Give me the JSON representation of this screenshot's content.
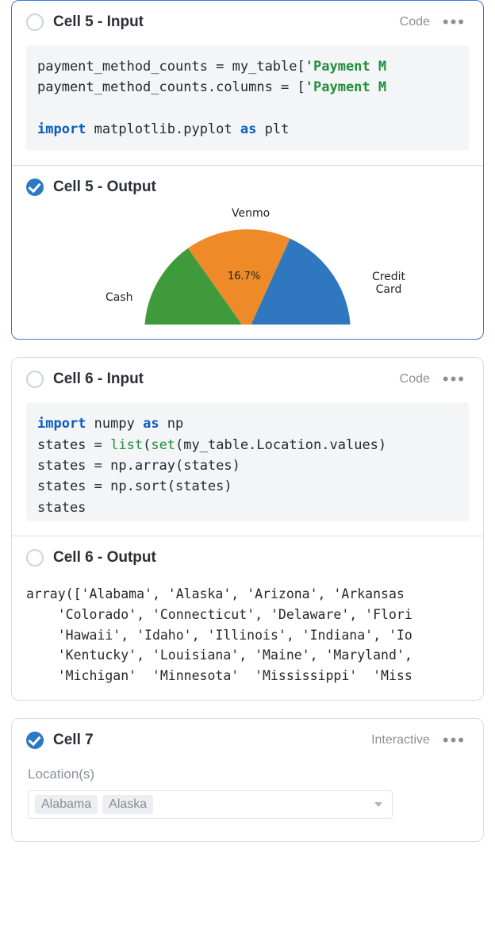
{
  "cells": [
    {
      "input_title": "Cell 5 - Input",
      "input_tag": "Code",
      "output_title": "Cell 5 - Output",
      "code_html": "payment_method_counts = my_table[<span class='kw-str'>'Payment M</span>\npayment_method_counts.columns = [<span class='kw-str'>'Payment M</span>\n\n<span class='kw-blue'>import</span> matplotlib.pyplot <span class='kw-blue'>as</span> plt"
    },
    {
      "input_title": "Cell 6 - Input",
      "input_tag": "Code",
      "output_title": "Cell 6 - Output",
      "code_html": "<span class='kw-blue'>import</span> numpy <span class='kw-blue'>as</span> np\nstates = <span class='kw-builtin'>list</span>(<span class='kw-builtin'>set</span>(my_table.Location.values)\nstates = np.array(states)\nstates = np.sort(states)\nstates",
      "output_text": "array(['Alabama', 'Alaska', 'Arizona', 'Arkansas\n    'Colorado', 'Connecticut', 'Delaware', 'Flori\n    'Hawaii', 'Idaho', 'Illinois', 'Indiana', 'Io\n    'Kentucky', 'Louisiana', 'Maine', 'Maryland',\n    'Michigan'  'Minnesota'  'Mississippi'  'Miss"
    },
    {
      "input_title": "Cell 7",
      "input_tag": "Interactive",
      "form": {
        "label": "Location(s)",
        "selected": [
          "Alabama",
          "Alaska"
        ]
      }
    }
  ],
  "chart_data": {
    "type": "pie",
    "title": "",
    "slices": [
      {
        "label": "Credit Card",
        "color": "#2f78bf"
      },
      {
        "label": "Venmo",
        "value_pct": 16.7,
        "color": "#ee8b28"
      },
      {
        "label": "Cash",
        "color": "#3e9a3a"
      }
    ],
    "note": "Only the top half of the pie is visible; '16.7%' is the only visible value label (on the Venmo slice)."
  }
}
